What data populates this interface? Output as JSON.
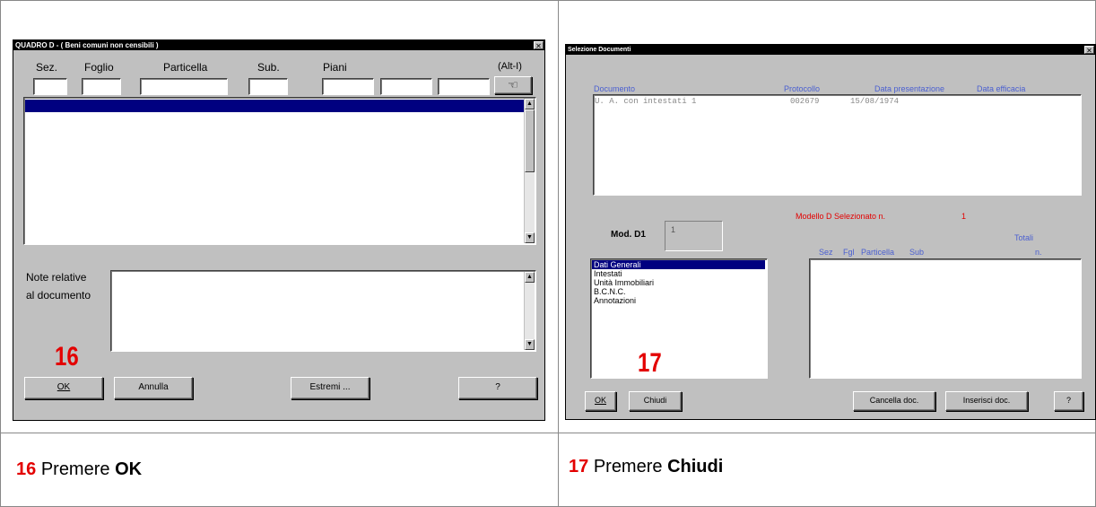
{
  "left_window": {
    "title": "QUADRO D  -  ( Beni comuni non censibili )",
    "close_glyph": "✕",
    "columns": [
      "Sez.",
      "Foglio",
      "Particella",
      "Sub.",
      "Piani",
      "(Alt-I)"
    ],
    "insert_icon": "hand-pointer-icon",
    "note_label_1": "Note relative",
    "note_label_2": "al documento",
    "step_number": "16",
    "buttons": {
      "ok": "OK",
      "annulla": "Annulla",
      "estremi": "Estremi ...",
      "help": "?"
    }
  },
  "right_window": {
    "title": "Selezione Documenti",
    "close_glyph": "✕",
    "doc_headers": {
      "documento": "Documento",
      "protocollo": "Protocollo",
      "data_presentazione": "Data presentazione",
      "data_efficacia": "Data efficacia"
    },
    "doc_row": {
      "documento": "U. A. con intestati  1",
      "protocollo": "002679",
      "data": "15/08/1974"
    },
    "modello_label": "Modello D Selezionato n.",
    "modello_value": "1",
    "mod_d1_label": "Mod. D1",
    "mod_d1_value": "1",
    "totali_label": "Totali",
    "n_label": "n.",
    "sub_headers": {
      "sez": "Sez",
      "fgl": "Fgl",
      "particella": "Particella",
      "sub": "Sub"
    },
    "sections": [
      "Dati Generali",
      "Intestati",
      "Unità Immobiliari",
      "B.C.N.C.",
      "Annotazioni"
    ],
    "step_number": "17",
    "buttons": {
      "ok": "OK",
      "chiudi": "Chiudi",
      "cancella": "Cancella doc.",
      "inserisci": "Inserisci doc.",
      "help": "?"
    }
  },
  "captions": {
    "left": {
      "number": "16",
      "text": "Premere",
      "bold": "OK"
    },
    "right": {
      "number": "17",
      "text": "Premere",
      "bold": "Chiudi"
    }
  },
  "colors": {
    "accent_red": "#e30000",
    "selection_blue": "#000080",
    "header_blue": "#4a5fd0"
  }
}
